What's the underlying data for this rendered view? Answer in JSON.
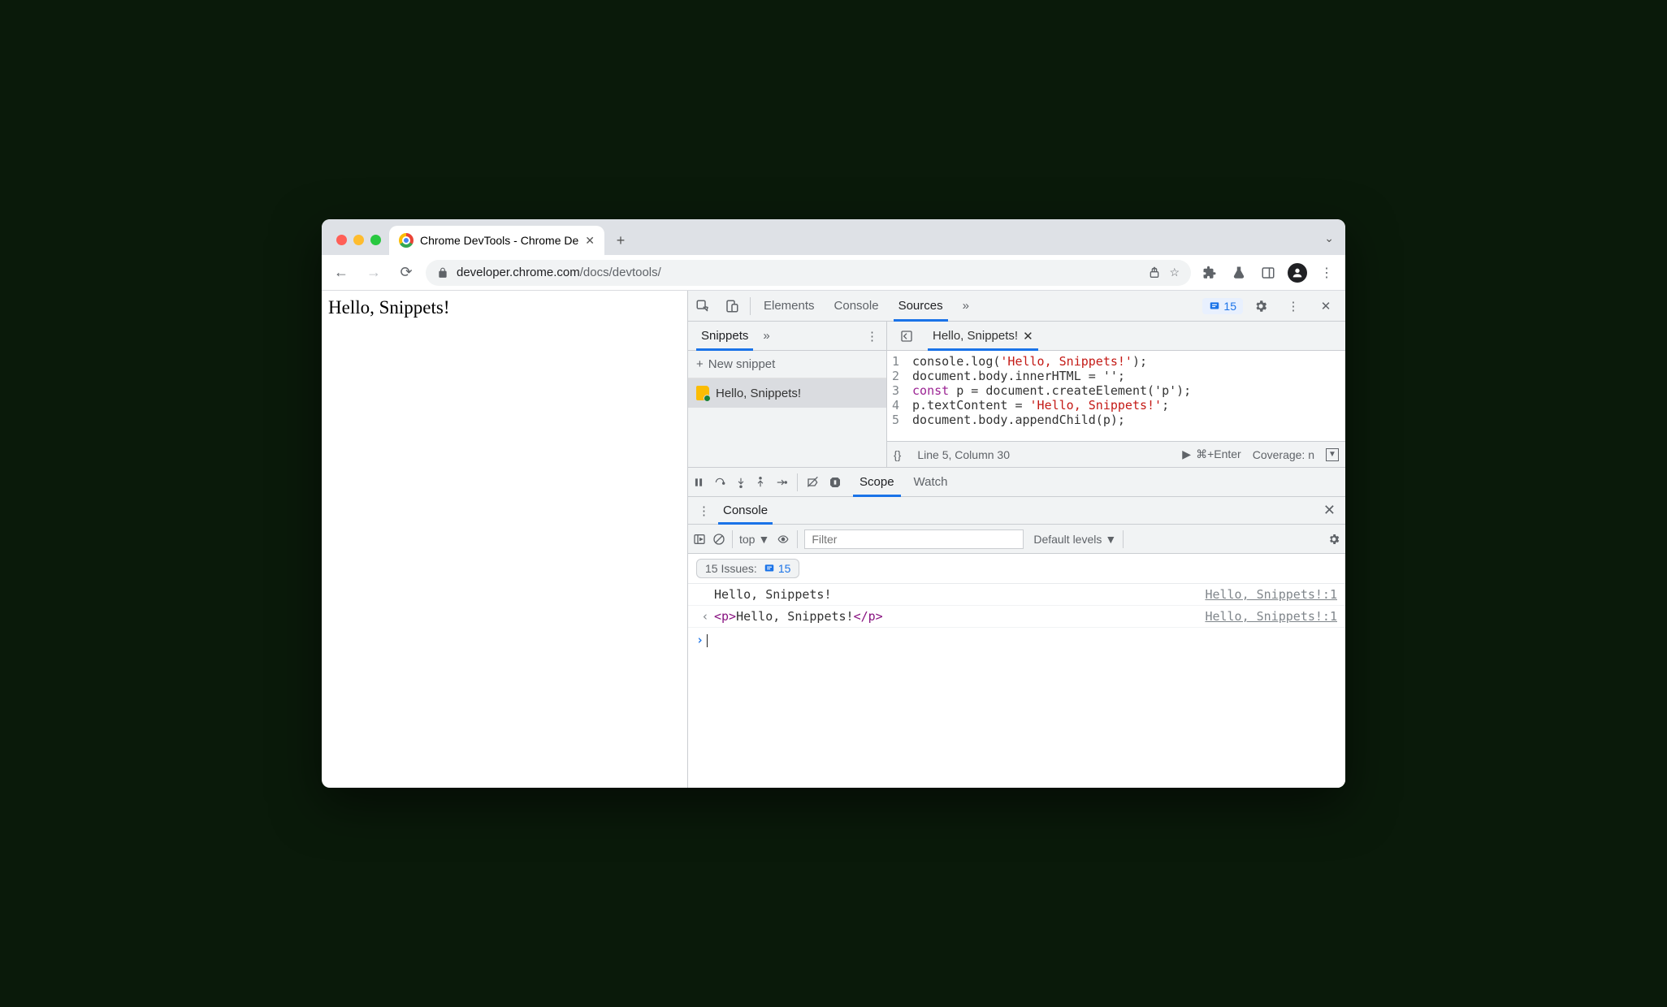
{
  "browser": {
    "tab_title": "Chrome DevTools - Chrome De",
    "url_host": "developer.chrome.com",
    "url_path": "/docs/devtools/"
  },
  "page": {
    "body_text": "Hello, Snippets!"
  },
  "devtools": {
    "tabs": {
      "elements": "Elements",
      "console": "Console",
      "sources": "Sources"
    },
    "issues_count": "15",
    "snippets": {
      "tab": "Snippets",
      "new_label": "New snippet",
      "item": "Hello, Snippets!"
    },
    "editor": {
      "open_tab": "Hello, Snippets!",
      "lines": [
        {
          "n": "1",
          "pre": "console.log(",
          "str": "'Hello, Snippets!'",
          "post": ");"
        },
        {
          "n": "2",
          "txt": "document.body.innerHTML = '';"
        },
        {
          "n": "3",
          "kw": "const",
          "rest": " p = document.createElement('p');"
        },
        {
          "n": "4",
          "pre": "p.textContent = ",
          "str": "'Hello, Snippets!'",
          "post": ";"
        },
        {
          "n": "5",
          "txt": "document.body.appendChild(p);"
        }
      ],
      "status": {
        "braces": "{}",
        "pos": "Line 5, Column 30",
        "run": "⌘+Enter",
        "coverage": "Coverage: n"
      }
    },
    "dbg_tabs": {
      "scope": "Scope",
      "watch": "Watch"
    },
    "drawer": {
      "tab": "Console",
      "context": "top",
      "filter_placeholder": "Filter",
      "levels": "Default levels",
      "issues_label": "15 Issues:",
      "issues_badge": "15",
      "rows": [
        {
          "pre": "",
          "msg": "Hello, Snippets!",
          "src": "Hello, Snippets!:1"
        },
        {
          "pre": "‹",
          "tag_open": "<p>",
          "body": "Hello, Snippets!",
          "tag_close": "</p>",
          "src": "Hello, Snippets!:1"
        }
      ]
    }
  }
}
